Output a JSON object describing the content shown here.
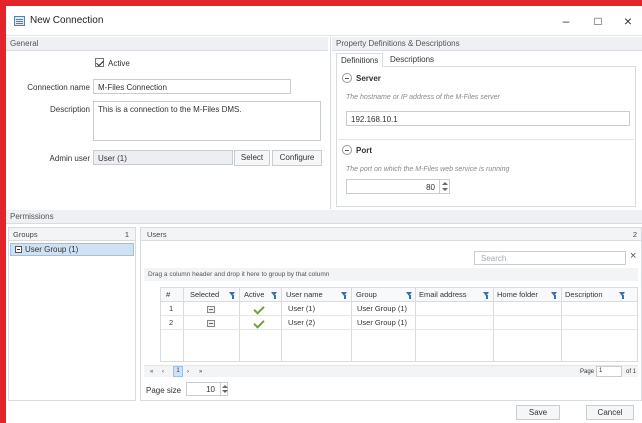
{
  "window": {
    "title": "New Connection",
    "minimize": "–",
    "maximize": "□",
    "close": "×"
  },
  "general": {
    "section_title": "General",
    "active_label": "Active",
    "active_checked": true,
    "connection_name_label": "Connection name",
    "connection_name_value": "M-Files Connection",
    "description_label": "Description",
    "description_value": "This is a connection to the M-Files DMS.",
    "admin_user_label": "Admin user",
    "admin_user_value": "User (1)",
    "select_button": "Select",
    "configure_button": "Configure"
  },
  "properties": {
    "section_title": "Property Definitions & Descriptions",
    "tabs": [
      {
        "label": "Definitions",
        "active": true
      },
      {
        "label": "Descriptions",
        "active": false
      }
    ],
    "server": {
      "title": "Server",
      "description": "The hostname or IP address of the M-Files server",
      "value": "192.168.10.1"
    },
    "port": {
      "title": "Port",
      "description": "The port on which the M-Files web service is running",
      "value": "80"
    }
  },
  "permissions": {
    "section_title": "Permissions",
    "groups_header": "Groups",
    "groups_count": "1",
    "groups": [
      {
        "label": "User Group (1)",
        "selected": true
      }
    ],
    "users_header": "Users",
    "users_count": "2",
    "search_placeholder": "Search",
    "clear_search": "×",
    "group_hint": "Drag a column header and drop it here to group by that column",
    "columns": [
      "#",
      "Selected",
      "Active",
      "User name",
      "Group",
      "Email address",
      "Home folder",
      "Description"
    ],
    "rows": [
      {
        "num": "1",
        "user": "User (1)",
        "group": "User Group (1)"
      },
      {
        "num": "2",
        "user": "User (2)",
        "group": "User Group (1)"
      }
    ],
    "pager": {
      "first": "«",
      "prev": "‹",
      "current": "1",
      "next": "›",
      "last": "»",
      "page_label": "Page",
      "page_value": "1",
      "of_label": "of 1"
    },
    "page_size_label": "Page size",
    "page_size_value": "10"
  },
  "footer": {
    "save": "Save",
    "cancel": "Cancel"
  },
  "colors": {
    "frame": "#e3242b",
    "accent": "#3b6ea5",
    "check": "#6aa83a"
  }
}
